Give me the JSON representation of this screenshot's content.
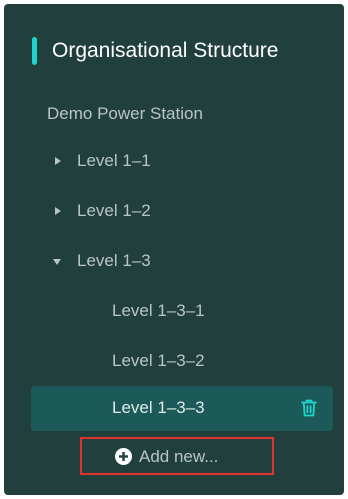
{
  "panel": {
    "title": "Organisational Structure",
    "root": "Demo Power Station"
  },
  "tree": {
    "level_1_1": {
      "label": "Level 1–1",
      "expanded": false
    },
    "level_1_2": {
      "label": "Level 1–2",
      "expanded": false
    },
    "level_1_3": {
      "label": "Level 1–3",
      "expanded": true
    },
    "level_1_3_1": {
      "label": "Level 1–3–1"
    },
    "level_1_3_2": {
      "label": "Level 1–3–2"
    },
    "level_1_3_3": {
      "label": "Level 1–3–3",
      "selected": true,
      "action_icon": "trash-icon"
    }
  },
  "actions": {
    "add_new_label": "Add new...",
    "add_new_icon": "plus-circle-icon"
  },
  "colors": {
    "panel_bg": "#203f3d",
    "accent": "#1fd4cf",
    "selected_row_bg": "#1c5a59",
    "highlight_border": "#e0332f"
  }
}
